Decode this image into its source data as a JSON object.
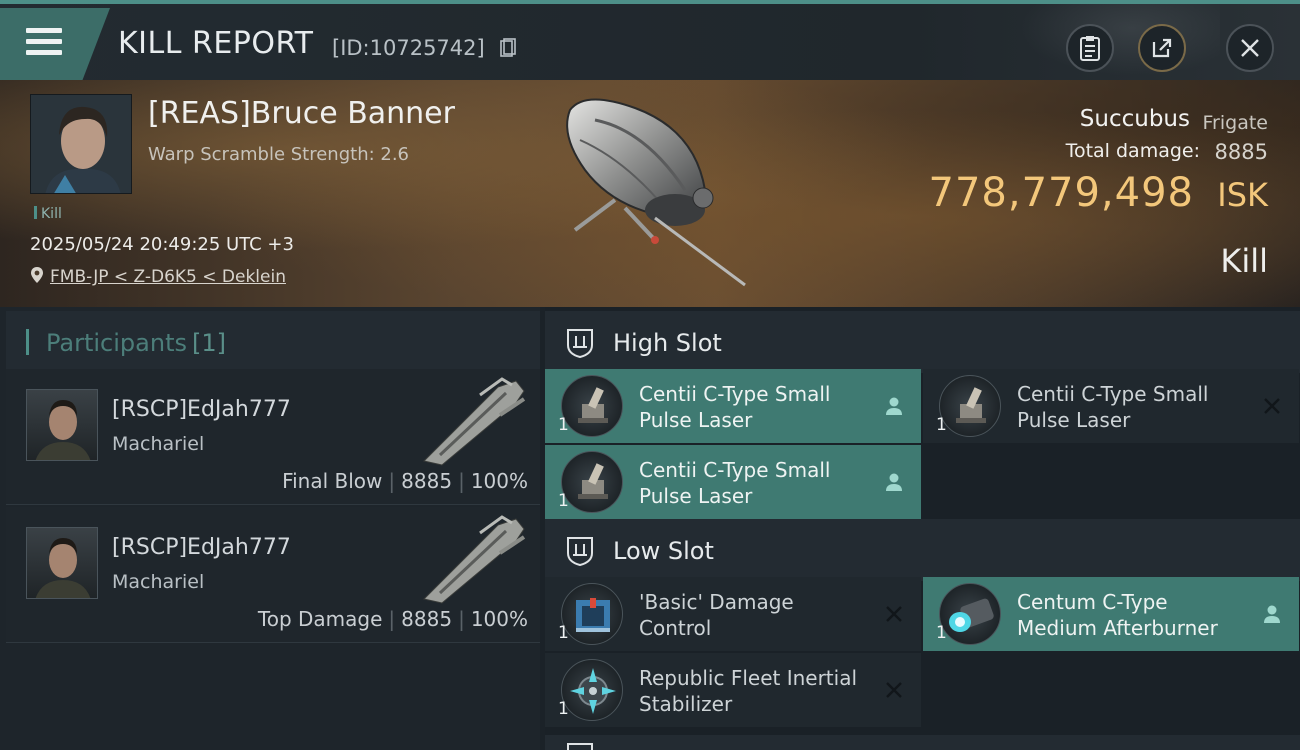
{
  "header": {
    "title": "KILL REPORT",
    "report_id": "[ID:10725742]"
  },
  "victim": {
    "name": "[REAS]Bruce Banner",
    "scram": "Warp Scramble Strength: 2.6",
    "tag": "Kill",
    "datetime": "2025/05/24 20:49:25 UTC +3",
    "location": "FMB-JP < Z-D6K5 < Deklein",
    "ship_name": "Succubus",
    "ship_class": "Frigate",
    "total_damage_label": "Total damage:",
    "total_damage": "8885",
    "isk_value": "778,779,498",
    "isk_unit": "ISK",
    "result": "Kill"
  },
  "participants": {
    "title": "Participants",
    "count": "[1]",
    "rows": [
      {
        "name": "[RSCP]EdJah777",
        "ship": "Machariel",
        "role": "Final Blow",
        "damage": "8885",
        "percent": "100%"
      },
      {
        "name": "[RSCP]EdJah777",
        "ship": "Machariel",
        "role": "Top Damage",
        "damage": "8885",
        "percent": "100%"
      }
    ]
  },
  "fitting": {
    "high_slot": {
      "label": "High Slot",
      "modules": [
        {
          "name": "Centii C-Type Small Pulse Laser",
          "qty": "1",
          "status": "fitted"
        },
        {
          "name": "Centii C-Type Small Pulse Laser",
          "qty": "1",
          "status": "destroyed"
        },
        {
          "name": "Centii C-Type Small Pulse Laser",
          "qty": "1",
          "status": "fitted"
        }
      ]
    },
    "low_slot": {
      "label": "Low Slot",
      "modules": [
        {
          "name": "'Basic' Damage Control",
          "qty": "1",
          "status": "destroyed"
        },
        {
          "name": "Centum C-Type Medium Afterburner",
          "qty": "1",
          "status": "fitted"
        },
        {
          "name": "Republic Fleet Inertial Stabilizer",
          "qty": "1",
          "status": "destroyed"
        }
      ]
    }
  },
  "colors": {
    "accent": "#4d8f88",
    "isk": "#f3c77b",
    "active_module": "#3f7a72"
  },
  "icons": [
    "menu-icon",
    "copy-icon",
    "clipboard-icon",
    "share-icon",
    "close-icon",
    "location-pin-icon",
    "shield-icon",
    "pilot-icon",
    "destroyed-x-icon"
  ]
}
